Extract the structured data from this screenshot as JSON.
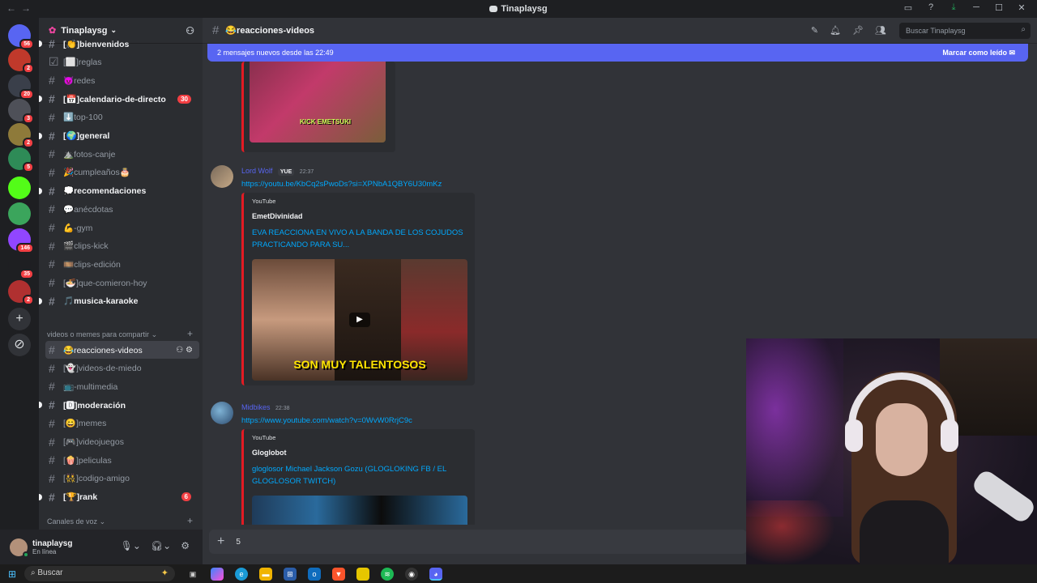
{
  "window": {
    "title": "Tinaplaysg"
  },
  "guilds": [
    {
      "color": "#5865f2",
      "badge": "56"
    },
    {
      "color": "#c0392b",
      "badge": "2"
    },
    {
      "color": "#3a3f4a",
      "badge": "20"
    },
    {
      "color": "#4e5058",
      "badge": "3"
    },
    {
      "color": "#8e7a3a",
      "badge": "2"
    },
    {
      "color": "#2e8b57",
      "badge": "5"
    },
    {
      "color": "#53fc18",
      "badge": ""
    },
    {
      "color": "#3ba55c",
      "badge": ""
    },
    {
      "color": "#9146ff",
      "badge": "146"
    },
    {
      "color": "#1e1f22",
      "badge": "35"
    },
    {
      "color": "#b03030",
      "badge": "2"
    }
  ],
  "server": {
    "name": "Tinaplaysg"
  },
  "channels": [
    {
      "label": "[👏]bienvenidos",
      "unread": true
    },
    {
      "label": "[⬜]reglas",
      "unread": false,
      "type": "rules"
    },
    {
      "label": "😈redes",
      "unread": false
    },
    {
      "label": "[📅]calendario-de-directo",
      "unread": true,
      "mentions": "30"
    },
    {
      "label": "⬇️top-100",
      "unread": false
    },
    {
      "label": "[🌍]general",
      "unread": true
    },
    {
      "label": "⛰️fotos-canje",
      "unread": false
    },
    {
      "label": "🎉cumpleaños🎂",
      "unread": false
    },
    {
      "label": "💭recomendaciones",
      "unread": true
    },
    {
      "label": "💬anécdotas",
      "unread": false
    },
    {
      "label": "💪-gym",
      "unread": false
    },
    {
      "label": "🎬clips-kick",
      "unread": false
    },
    {
      "label": "🎞️clips-edición",
      "unread": false
    },
    {
      "label": "[🍜]que-comieron-hoy",
      "unread": false
    },
    {
      "label": "🎵musica-karaoke",
      "unread": true
    }
  ],
  "category1": {
    "label": "videos o memes para compartir"
  },
  "channels2": [
    {
      "label": "😂reacciones-videos",
      "active": true
    },
    {
      "label": "[👻]videos-de-miedo",
      "unread": false
    },
    {
      "label": "📺-multimedia",
      "unread": false
    },
    {
      "label": "[🅳]moderación",
      "unread": true
    },
    {
      "label": "[😄]memes",
      "unread": false
    },
    {
      "label": "[🎮]videojuegos",
      "unread": false
    },
    {
      "label": "[🍿]peliculas",
      "unread": false
    },
    {
      "label": "[👯]codigo-amigo",
      "unread": false
    },
    {
      "label": "[🏆]rank",
      "unread": true,
      "mentions": "6"
    }
  ],
  "category2": {
    "label": "Canales de voz"
  },
  "user": {
    "name": "tinaplaysg",
    "status": "En línea"
  },
  "header": {
    "channel": "😂reacciones-videos",
    "search_placeholder": "Buscar Tinaplaysg"
  },
  "newbar": {
    "text": "2 mensajes nuevos desde las 22:49",
    "action": "Marcar como leído"
  },
  "thumb1": {
    "caption": "KICK EMETSUKI"
  },
  "messages": [
    {
      "author": "Lord Wolf",
      "tag": "YUE",
      "time": "22:37",
      "link": "https://youtu.be/KbCq2sPwoDs?si=XPNbA1QBY6U30mKz",
      "embed": {
        "provider": "YouTube",
        "channel": "EmetDivinidad",
        "title": "EVA REACCIONA EN VIVO A LA BANDA DE LOS COJUDOS PRACTICANDO PARA SU...",
        "caption": "SON MUY TALENTOSOS"
      }
    },
    {
      "author": "Midbikes",
      "time": "22:38",
      "link": "https://www.youtube.com/watch?v=0WvW0RrjC9c",
      "embed": {
        "provider": "YouTube",
        "channel": "Gloglobot",
        "title": "gloglosor Michael Jackson Gozu (GLOGLOKING FB / EL GLOGLOSOR TWITCH)"
      }
    }
  ],
  "input": {
    "value": "5"
  },
  "taskbar": {
    "search": "Buscar"
  }
}
